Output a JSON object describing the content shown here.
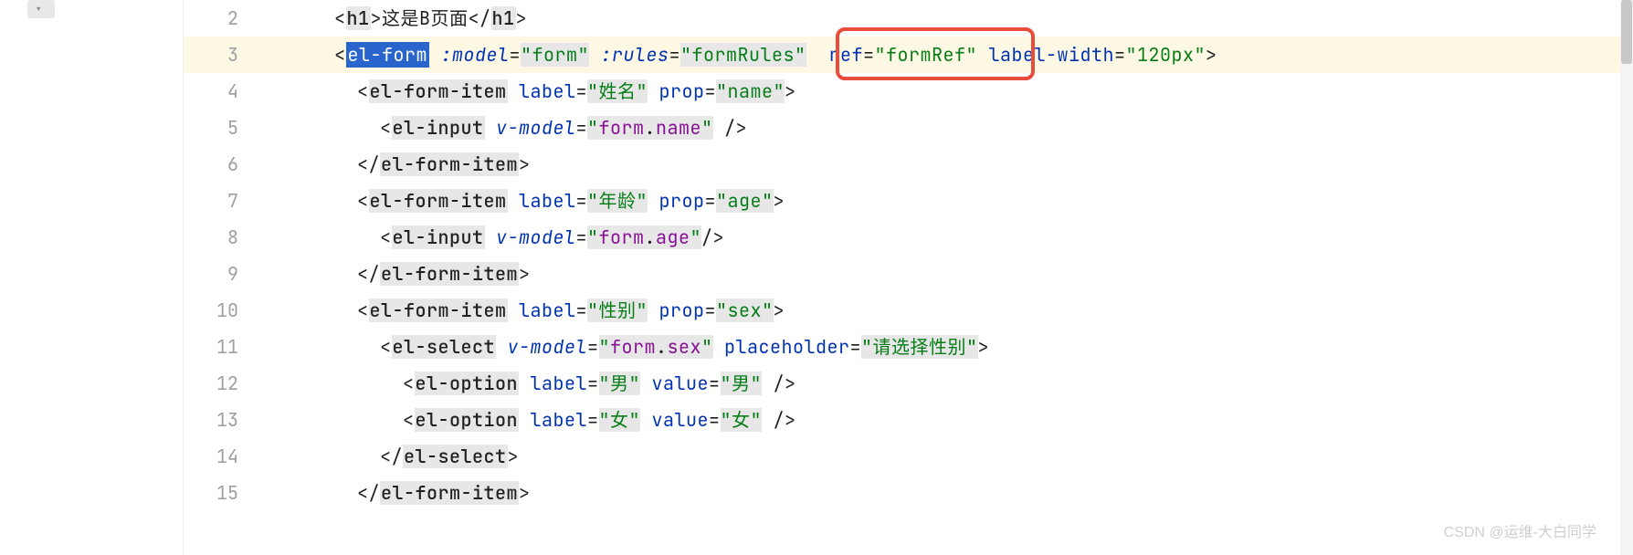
{
  "gutter": {
    "start": 2,
    "end": 15
  },
  "highlighted_line": 3,
  "code": {
    "l2": {
      "indent": "      ",
      "tag_open": "<",
      "tag": "h1",
      "tag_close": ">",
      "text": "这是B页面",
      "end_open": "</",
      "end_tag": "h1",
      "end_close": ">"
    },
    "l3": {
      "indent": "      ",
      "open": "<",
      "tag": "el-form",
      "a1": ":model",
      "v1": "\"form\"",
      "a2": ":rules",
      "v2": "\"formRules\"",
      "a3": "ref",
      "v3": "\"formRef\"",
      "a4": "label-width",
      "v4": "\"120px\"",
      "close": ">"
    },
    "l4": {
      "indent": "        ",
      "open": "<",
      "tag": "el-form-item",
      "a1": "label",
      "v1": "\"姓名\"",
      "a2": "prop",
      "v2": "\"name\"",
      "close": ">"
    },
    "l5": {
      "indent": "          ",
      "open": "<",
      "tag": "el-input",
      "a1": "v-model",
      "v1_pre": "\"",
      "v1_obj": "form",
      "v1_dot": ".",
      "v1_prop": "name",
      "v1_post": "\"",
      "close": " />"
    },
    "l6": {
      "indent": "        ",
      "open": "</",
      "tag": "el-form-item",
      "close": ">"
    },
    "l7": {
      "indent": "        ",
      "open": "<",
      "tag": "el-form-item",
      "a1": "label",
      "v1": "\"年龄\"",
      "a2": "prop",
      "v2": "\"age\"",
      "close": ">"
    },
    "l8": {
      "indent": "          ",
      "open": "<",
      "tag": "el-input",
      "a1": "v-model",
      "v1_pre": "\"",
      "v1_obj": "form",
      "v1_dot": ".",
      "v1_prop": "age",
      "v1_post": "\"",
      "close": "/>"
    },
    "l9": {
      "indent": "        ",
      "open": "</",
      "tag": "el-form-item",
      "close": ">"
    },
    "l10": {
      "indent": "        ",
      "open": "<",
      "tag": "el-form-item",
      "a1": "label",
      "v1": "\"性别\"",
      "a2": "prop",
      "v2": "\"sex\"",
      "close": ">"
    },
    "l11": {
      "indent": "          ",
      "open": "<",
      "tag": "el-select",
      "a1": "v-model",
      "v1_pre": "\"",
      "v1_obj": "form",
      "v1_dot": ".",
      "v1_prop": "sex",
      "v1_post": "\"",
      "a2": "placeholder",
      "v2": "\"请选择性别\"",
      "close": ">"
    },
    "l12": {
      "indent": "            ",
      "open": "<",
      "tag": "el-option",
      "a1": "label",
      "v1": "\"男\"",
      "a2": "value",
      "v2": "\"男\"",
      "close": " />"
    },
    "l13": {
      "indent": "            ",
      "open": "<",
      "tag": "el-option",
      "a1": "label",
      "v1": "\"女\"",
      "a2": "value",
      "v2": "\"女\"",
      "close": " />"
    },
    "l14": {
      "indent": "          ",
      "open": "</",
      "tag": "el-select",
      "close": ">"
    },
    "l15": {
      "indent": "        ",
      "open": "</",
      "tag": "el-form-item",
      "close": ">"
    }
  },
  "annotation": {
    "watermark": "CSDN @运维-大白同学"
  }
}
